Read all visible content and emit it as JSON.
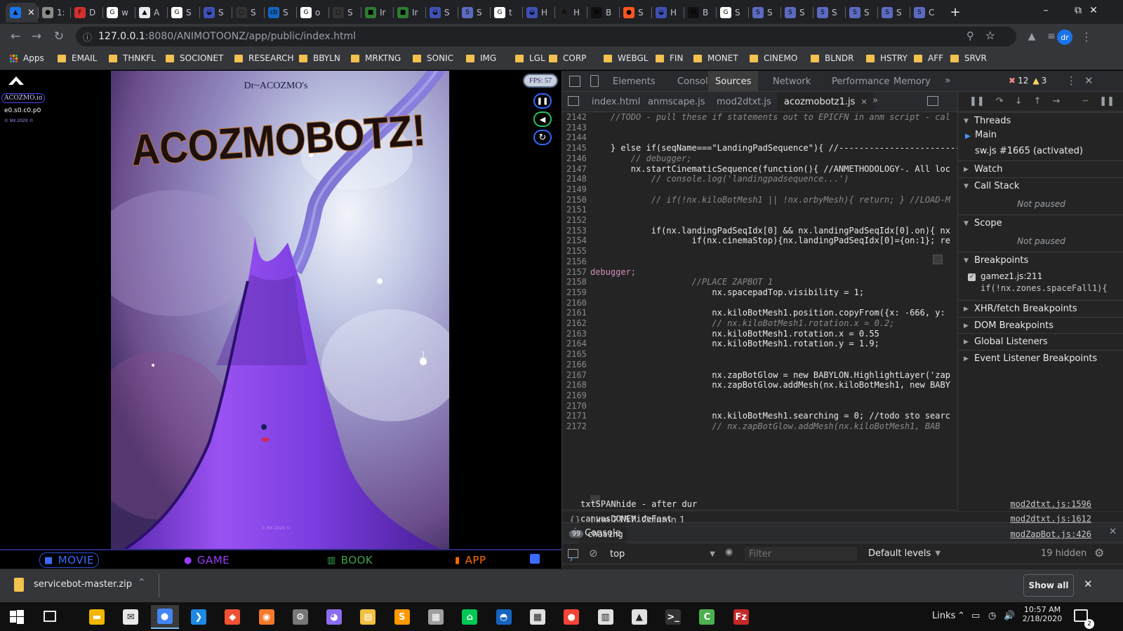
{
  "browser": {
    "tabs": [
      {
        "label": "A",
        "color": "#1a73e8",
        "glyph": "▲"
      },
      {
        "label": "1:",
        "color": "#8a8a8a",
        "glyph": "●"
      },
      {
        "label": "D",
        "color": "#d32f2f",
        "glyph": "F"
      },
      {
        "label": "w",
        "color": "#ffffff",
        "glyph": "G"
      },
      {
        "label": "A",
        "color": "#e8eaed",
        "glyph": "▲"
      },
      {
        "label": "S",
        "color": "#ffffff",
        "glyph": "G"
      },
      {
        "label": "S",
        "color": "#3f51b5",
        "glyph": "◒"
      },
      {
        "label": "S",
        "color": "#333333",
        "glyph": "○"
      },
      {
        "label": "S",
        "color": "#1565c0",
        "glyph": "cb"
      },
      {
        "label": "o",
        "color": "#ffffff",
        "glyph": "G"
      },
      {
        "label": "S",
        "color": "#333333",
        "glyph": "○"
      },
      {
        "label": "Ir",
        "color": "#2e7d32",
        "glyph": "■"
      },
      {
        "label": "Ir",
        "color": "#2e7d32",
        "glyph": "■"
      },
      {
        "label": "S",
        "color": "#3f51b5",
        "glyph": "◒"
      },
      {
        "label": "S",
        "color": "#5c6bc0",
        "glyph": "S"
      },
      {
        "label": "t",
        "color": "#ffffff",
        "glyph": "G"
      },
      {
        "label": "H",
        "color": "#3f51b5",
        "glyph": "◒"
      },
      {
        "label": "H",
        "color": "#222222",
        "glyph": "A"
      },
      {
        "label": "B",
        "color": "#111111",
        "glyph": "M"
      },
      {
        "label": "S",
        "color": "#ff5722",
        "glyph": "●"
      },
      {
        "label": "H",
        "color": "#3f51b5",
        "glyph": "◒"
      },
      {
        "label": "B",
        "color": "#111111",
        "glyph": "M"
      },
      {
        "label": "S",
        "color": "#ffffff",
        "glyph": "G"
      },
      {
        "label": "S",
        "color": "#5c6bc0",
        "glyph": "S"
      },
      {
        "label": "S",
        "color": "#5c6bc0",
        "glyph": "S"
      },
      {
        "label": "S",
        "color": "#5c6bc0",
        "glyph": "S"
      },
      {
        "label": "S",
        "color": "#5c6bc0",
        "glyph": "S"
      },
      {
        "label": "S",
        "color": "#5c6bc0",
        "glyph": "S"
      },
      {
        "label": "C",
        "color": "#5c6bc0",
        "glyph": "S"
      }
    ],
    "url_host": "127.0.0.1",
    "url_path": ":8080/ANIMOTOONZ/app/public/index.html",
    "profile": "dr",
    "bookmarks": [
      "Apps",
      "EMAIL",
      "THNKFL",
      "SOCIONET",
      "RESEARCH",
      "BBYLN",
      "MRKTNG",
      "SONIC",
      "IMG",
      "LGL",
      "CORP",
      "WEBGL",
      "FIN",
      "MONET",
      "CINEMO",
      "BLNDR",
      "HSTRY",
      "AFF",
      "SRVR"
    ]
  },
  "app": {
    "side_logo": "ACOZMO.io",
    "side_version": "e0.s0.c0.p0",
    "side_copyright": "© NX 2020 ©",
    "subtitle": "Dr~ACOZMO's",
    "title": "ACOZMOBOTZ!",
    "footer_mark": "© NX 2020 ©",
    "fps": "FPS: 57",
    "nav": [
      {
        "label": "MOVIE",
        "color": "#3b6bff"
      },
      {
        "label": "GAME",
        "color": "#9b3bff"
      },
      {
        "label": "BOOK",
        "color": "#3fa34d"
      },
      {
        "label": "APP",
        "color": "#ff6a00"
      }
    ]
  },
  "devtools": {
    "tabs": [
      "Elements",
      "Console",
      "Sources",
      "Network",
      "Performance",
      "Memory"
    ],
    "active_tab": "Sources",
    "errors": "12",
    "warnings": "3",
    "files": [
      "index.html",
      "anmscape.js",
      "mod2dtxt.js",
      "acozmobotz1.js"
    ],
    "active_file": "acozmobotz1.js",
    "code_lines": [
      {
        "n": "2142",
        "t": "    //TODO - pull these if statements out to EPICFN in anm script - cal",
        "c": "cm"
      },
      {
        "n": "2143",
        "t": "",
        "c": "src"
      },
      {
        "n": "2144",
        "t": "",
        "c": "src"
      },
      {
        "n": "2145",
        "t": "    } else if(seqName===\"LandingPadSequence\"){ //-----------------------------",
        "c": "src"
      },
      {
        "n": "2146",
        "t": "        // debugger;",
        "c": "cm"
      },
      {
        "n": "2147",
        "t": "        nx.startCinematicSequence(function(){ //ANMETHODOLOGY-. All loc",
        "c": "src"
      },
      {
        "n": "2148",
        "t": "            // console.log('landingpadsequence...')",
        "c": "cm"
      },
      {
        "n": "2149",
        "t": "",
        "c": "src"
      },
      {
        "n": "2150",
        "t": "            // if(!nx.kiloBotMesh1 || !nx.orbyMesh){ return; } //LOAD-M",
        "c": "cm"
      },
      {
        "n": "2151",
        "t": "",
        "c": "src"
      },
      {
        "n": "2152",
        "t": "",
        "c": "src"
      },
      {
        "n": "2153",
        "t": "            if(nx.landingPadSeqIdx[0] && nx.landingPadSeqIdx[0].on){ nx",
        "c": "src"
      },
      {
        "n": "2154",
        "t": "                    if(nx.cinemaStop){nx.landingPadSeqIdx[0]={on:1}; re",
        "c": "src"
      },
      {
        "n": "2155",
        "t": "",
        "c": "src"
      },
      {
        "n": "2156",
        "t": "",
        "c": "src"
      },
      {
        "n": "2157",
        "t": "debugger;",
        "c": "kw"
      },
      {
        "n": "2158",
        "t": "                    //PLACE ZAPBOT 1",
        "c": "cm"
      },
      {
        "n": "2159",
        "t": "                        nx.spacepadTop.visibility = 1;",
        "c": "src"
      },
      {
        "n": "2160",
        "t": "",
        "c": "src"
      },
      {
        "n": "2161",
        "t": "                        nx.kiloBotMesh1.position.copyFrom({x: -666, y:",
        "c": "src"
      },
      {
        "n": "2162",
        "t": "                        // nx.kiloBotMesh1.rotation.x = 0.2;",
        "c": "cm"
      },
      {
        "n": "2163",
        "t": "                        nx.kiloBotMesh1.rotation.x = 0.55",
        "c": "src"
      },
      {
        "n": "2164",
        "t": "                        nx.kiloBotMesh1.rotation.y = 1.9;",
        "c": "src"
      },
      {
        "n": "2165",
        "t": "",
        "c": "src"
      },
      {
        "n": "2166",
        "t": "",
        "c": "src"
      },
      {
        "n": "2167",
        "t": "                        nx.zapBotGlow = new BABYLON.HighlightLayer('zap",
        "c": "src"
      },
      {
        "n": "2168",
        "t": "                        nx.zapBotGlow.addMesh(nx.kiloBotMesh1, new BABY",
        "c": "src"
      },
      {
        "n": "2169",
        "t": "",
        "c": "src"
      },
      {
        "n": "2170",
        "t": "",
        "c": "src"
      },
      {
        "n": "2171",
        "t": "                        nx.kiloBotMesh1.searching = 0; //todo sto searc",
        "c": "src"
      },
      {
        "n": "2172",
        "t": "                        // nx.zapBotGlow.addMesh(nx.kiloBotMesh1, BAB",
        "c": "cm"
      }
    ],
    "status": "Line 2157, Column 1",
    "threads": {
      "label": "Threads",
      "items": [
        "Main",
        "sw.js #1665 (activated)"
      ]
    },
    "watch": "Watch",
    "call_stack": "Call Stack",
    "not_paused": "Not paused",
    "scope": "Scope",
    "breakpoints": {
      "label": "Breakpoints",
      "file": "gamez1.js:211",
      "code": "if(!nx.zones.spaceFall1){"
    },
    "sections": [
      "XHR/fetch Breakpoints",
      "DOM Breakpoints",
      "Global Listeners",
      "Event Listener Breakpoints"
    ],
    "console": {
      "title": "Console",
      "context": "top",
      "filter_placeholder": "Filter",
      "levels": "Default levels",
      "hidden": "19 hidden",
      "messages": [
        {
          "text": "txtSPANhide - after dur",
          "source": "mod2dtxt.js:1596",
          "count": ""
        },
        {
          "text": "canvasDONEHideFast",
          "source": "mod2dtxt.js:1612",
          "count": ""
        },
        {
          "text": "chasing",
          "source": "modZapBot.js:426",
          "count": "99"
        }
      ],
      "prompt": "›"
    }
  },
  "downloads": {
    "file": "servicebot-master.zip",
    "show_all": "Show all"
  },
  "taskbar": {
    "apps": [
      {
        "name": "file-explorer",
        "color": "#f2b600",
        "glyph": "▬"
      },
      {
        "name": "mail",
        "color": "#e8e8e8",
        "glyph": "✉"
      },
      {
        "name": "chrome",
        "color": "#4285f4",
        "glyph": "●"
      },
      {
        "name": "vscode",
        "color": "#1e88e5",
        "glyph": "❯"
      },
      {
        "name": "git",
        "color": "#f05133",
        "glyph": "◆"
      },
      {
        "name": "blender",
        "color": "#f5792a",
        "glyph": "◉"
      },
      {
        "name": "tool",
        "color": "#777777",
        "glyph": "⚙"
      },
      {
        "name": "paint3d",
        "color": "#8e6cf0",
        "glyph": "◕"
      },
      {
        "name": "folder-tool",
        "color": "#f0c040",
        "glyph": "▤"
      },
      {
        "name": "sublime",
        "color": "#ff9800",
        "glyph": "S"
      },
      {
        "name": "doc-tool",
        "color": "#9e9e9e",
        "glyph": "▦"
      },
      {
        "name": "sourcetree",
        "color": "#00c853",
        "glyph": "⌂"
      },
      {
        "name": "game-app",
        "color": "#1565c0",
        "glyph": "◓"
      },
      {
        "name": "calculator",
        "color": "#e0e0e0",
        "glyph": "▦"
      },
      {
        "name": "browser2",
        "color": "#f44336",
        "glyph": "●"
      },
      {
        "name": "clapper",
        "color": "#e0e0e0",
        "glyph": "▥"
      },
      {
        "name": "photos",
        "color": "#e0e0e0",
        "glyph": "▲"
      },
      {
        "name": "terminal",
        "color": "#333333",
        "glyph": ">_"
      },
      {
        "name": "camtasia",
        "color": "#4caf50",
        "glyph": "C"
      },
      {
        "name": "filezilla",
        "color": "#c62828",
        "glyph": "Fz"
      }
    ],
    "links": "Links",
    "time": "10:57 AM",
    "date": "2/18/2020",
    "notifications": "2"
  }
}
